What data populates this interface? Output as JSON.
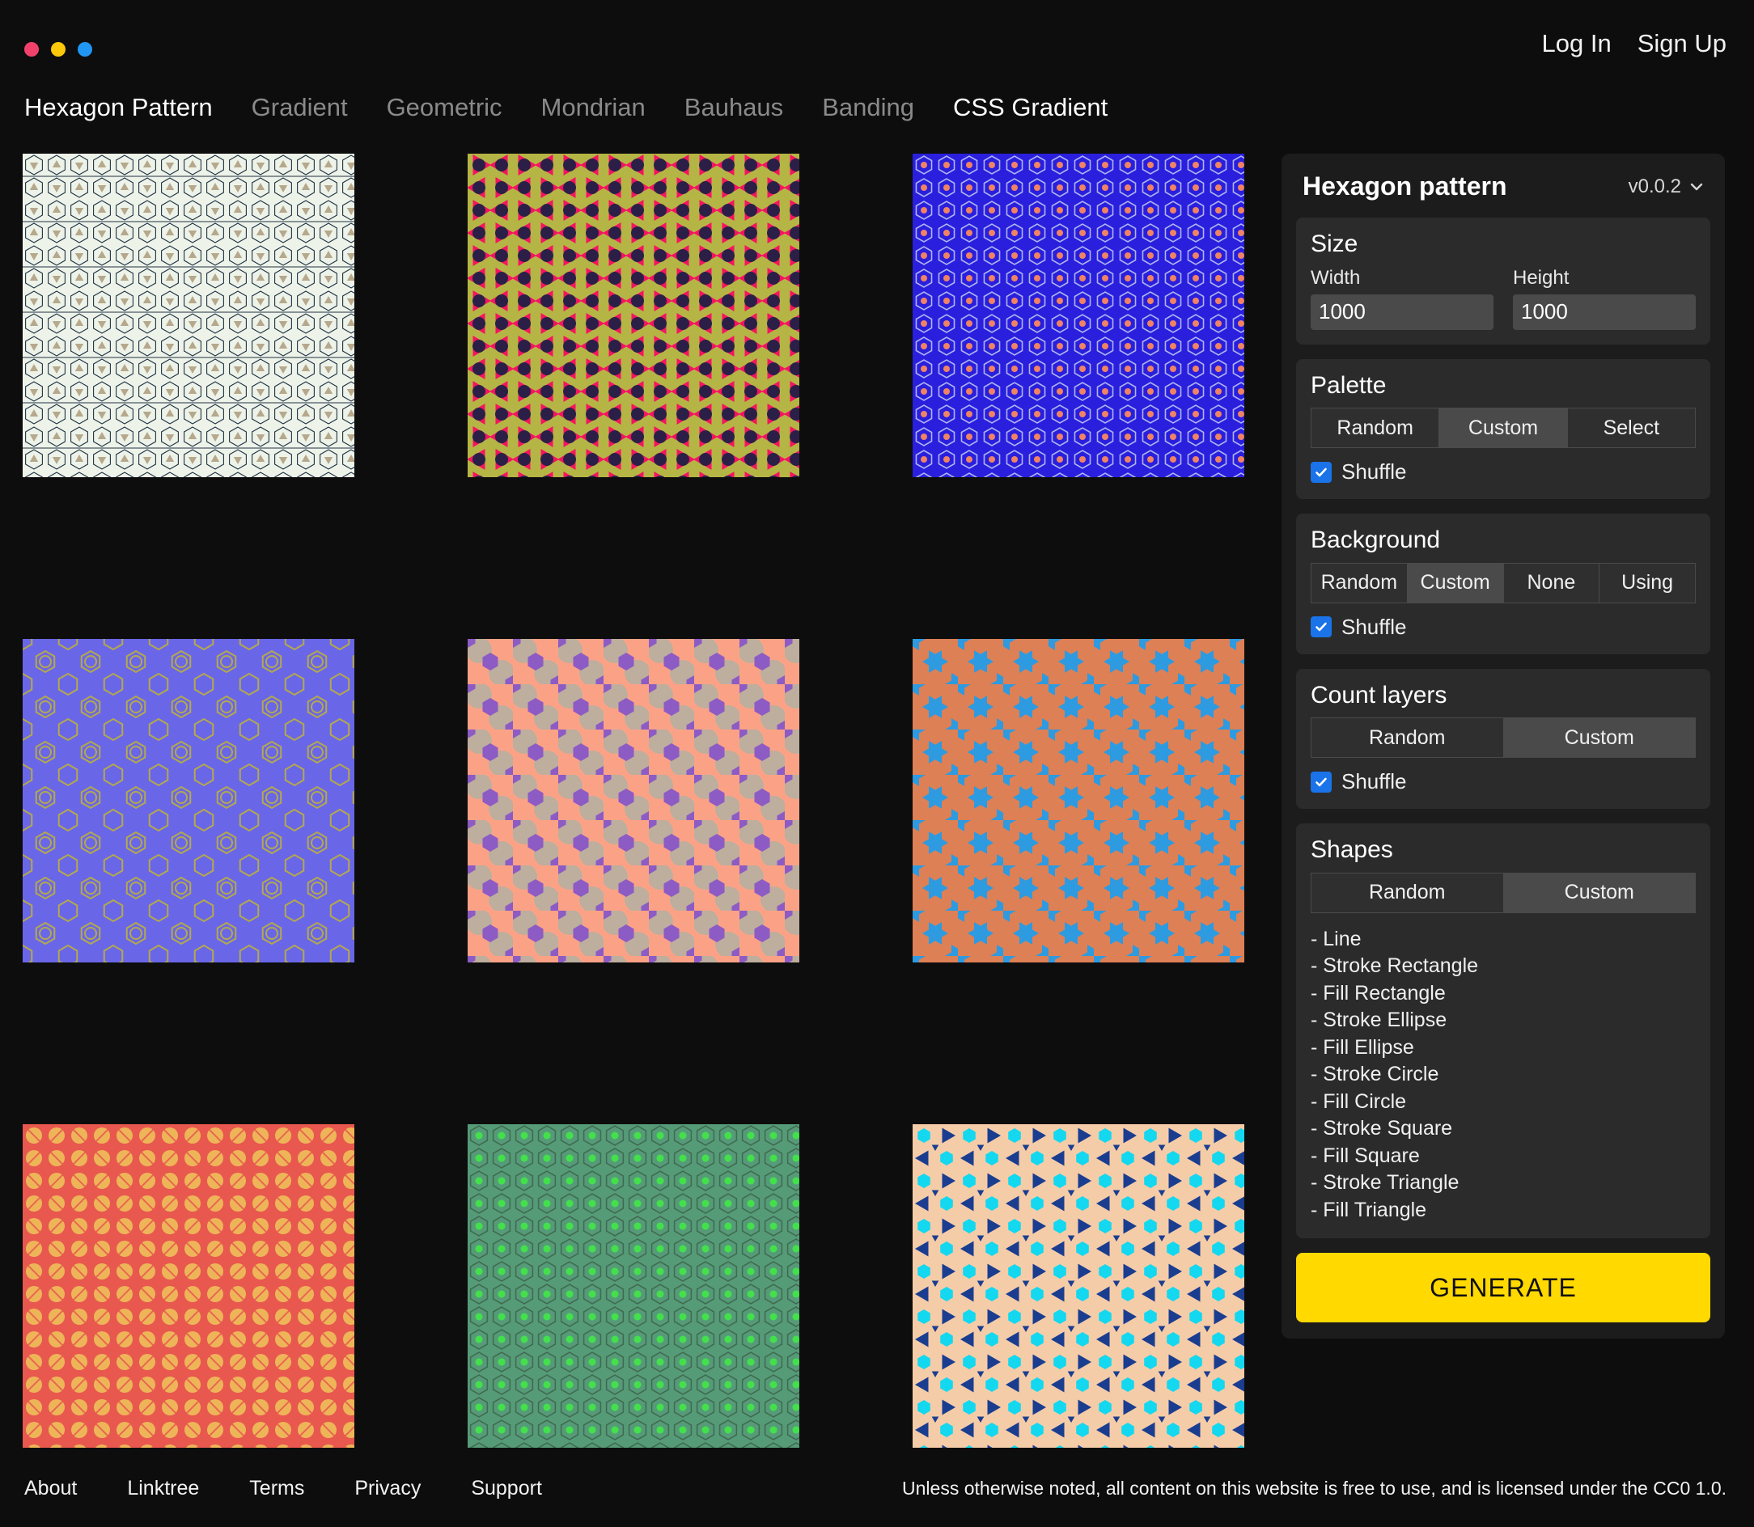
{
  "window": {
    "dots": [
      {
        "name": "close-dot",
        "color": "#f2426b"
      },
      {
        "name": "minimize-dot",
        "color": "#fcc80a"
      },
      {
        "name": "maximize-dot",
        "color": "#2196f3"
      }
    ]
  },
  "header": {
    "auth": [
      {
        "label": "Log In"
      },
      {
        "label": "Sign Up"
      }
    ]
  },
  "nav": {
    "items": [
      {
        "label": "Hexagon Pattern",
        "active": true
      },
      {
        "label": "Gradient",
        "active": false
      },
      {
        "label": "Geometric",
        "active": false
      },
      {
        "label": "Mondrian",
        "active": false
      },
      {
        "label": "Bauhaus",
        "active": false
      },
      {
        "label": "Banding",
        "active": false
      },
      {
        "label": "CSS Gradient",
        "active": true
      }
    ]
  },
  "gallery": {
    "tiles": [
      {
        "name": "pattern-tile-1",
        "bg": "#eef3e9",
        "fg": "#1d3043",
        "accent": "#b5a88c"
      },
      {
        "name": "pattern-tile-2",
        "bg": "#b5b545",
        "fg": "#2b1f47",
        "accent": "#f5145f"
      },
      {
        "name": "pattern-tile-3",
        "bg": "#2a1fdd",
        "fg": "#aeb4f0",
        "accent": "#f08363"
      },
      {
        "name": "pattern-tile-4",
        "bg": "#6a66e8",
        "fg": "#b3a94c",
        "accent": "#b3a94c"
      },
      {
        "name": "pattern-tile-5",
        "bg": "#fba286",
        "fg": "#8d5bc4",
        "accent": "#bdae9e"
      },
      {
        "name": "pattern-tile-6",
        "bg": "#dd8055",
        "fg": "#2e9ae0",
        "accent": "#2e9ae0"
      },
      {
        "name": "pattern-tile-7",
        "bg": "#e8584f",
        "fg": "#eeb558",
        "accent": "#eeb558"
      },
      {
        "name": "pattern-tile-8",
        "bg": "#569b78",
        "fg": "#43e04c",
        "accent": "#3f6b52"
      },
      {
        "name": "pattern-tile-9",
        "bg": "#f5cca8",
        "fg": "#13d8ef",
        "accent": "#1a3d8f"
      }
    ]
  },
  "panel": {
    "title": "Hexagon pattern",
    "version": "v0.0.2",
    "size": {
      "heading": "Size",
      "width_label": "Width",
      "width_value": "1000",
      "height_label": "Height",
      "height_value": "1000"
    },
    "palette": {
      "heading": "Palette",
      "options": [
        {
          "label": "Random",
          "selected": false
        },
        {
          "label": "Custom",
          "selected": true
        },
        {
          "label": "Select",
          "selected": false
        }
      ],
      "shuffle_label": "Shuffle",
      "shuffle_checked": true
    },
    "background": {
      "heading": "Background",
      "options": [
        {
          "label": "Random",
          "selected": false
        },
        {
          "label": "Custom",
          "selected": true
        },
        {
          "label": "None",
          "selected": false
        },
        {
          "label": "Using",
          "selected": false
        }
      ],
      "shuffle_label": "Shuffle",
      "shuffle_checked": true
    },
    "count_layers": {
      "heading": "Count layers",
      "options": [
        {
          "label": "Random",
          "selected": false
        },
        {
          "label": "Custom",
          "selected": true
        }
      ],
      "shuffle_label": "Shuffle",
      "shuffle_checked": true
    },
    "shapes": {
      "heading": "Shapes",
      "options": [
        {
          "label": "Random",
          "selected": false
        },
        {
          "label": "Custom",
          "selected": true
        }
      ],
      "items": [
        "- Line",
        "- Stroke Rectangle",
        "- Fill Rectangle",
        "- Stroke Ellipse",
        "- Fill Ellipse",
        "- Stroke Circle",
        "- Fill Circle",
        "- Stroke Square",
        "- Fill Square",
        "- Stroke Triangle",
        "- Fill Triangle"
      ]
    },
    "generate_label": "GENERATE"
  },
  "footer": {
    "links": [
      {
        "label": "About"
      },
      {
        "label": "Linktree"
      },
      {
        "label": "Terms"
      },
      {
        "label": "Privacy"
      },
      {
        "label": "Support"
      }
    ],
    "license": "Unless otherwise noted, all content on this website is free to use, and is licensed under the CC0 1.0."
  },
  "colors": {
    "page_bg": "#0d0d0d",
    "panel_bg": "#1c1c1c",
    "group_bg": "#2b2b2b",
    "accent_yellow": "#ffd900",
    "checkbox_blue": "#1a73e8"
  }
}
